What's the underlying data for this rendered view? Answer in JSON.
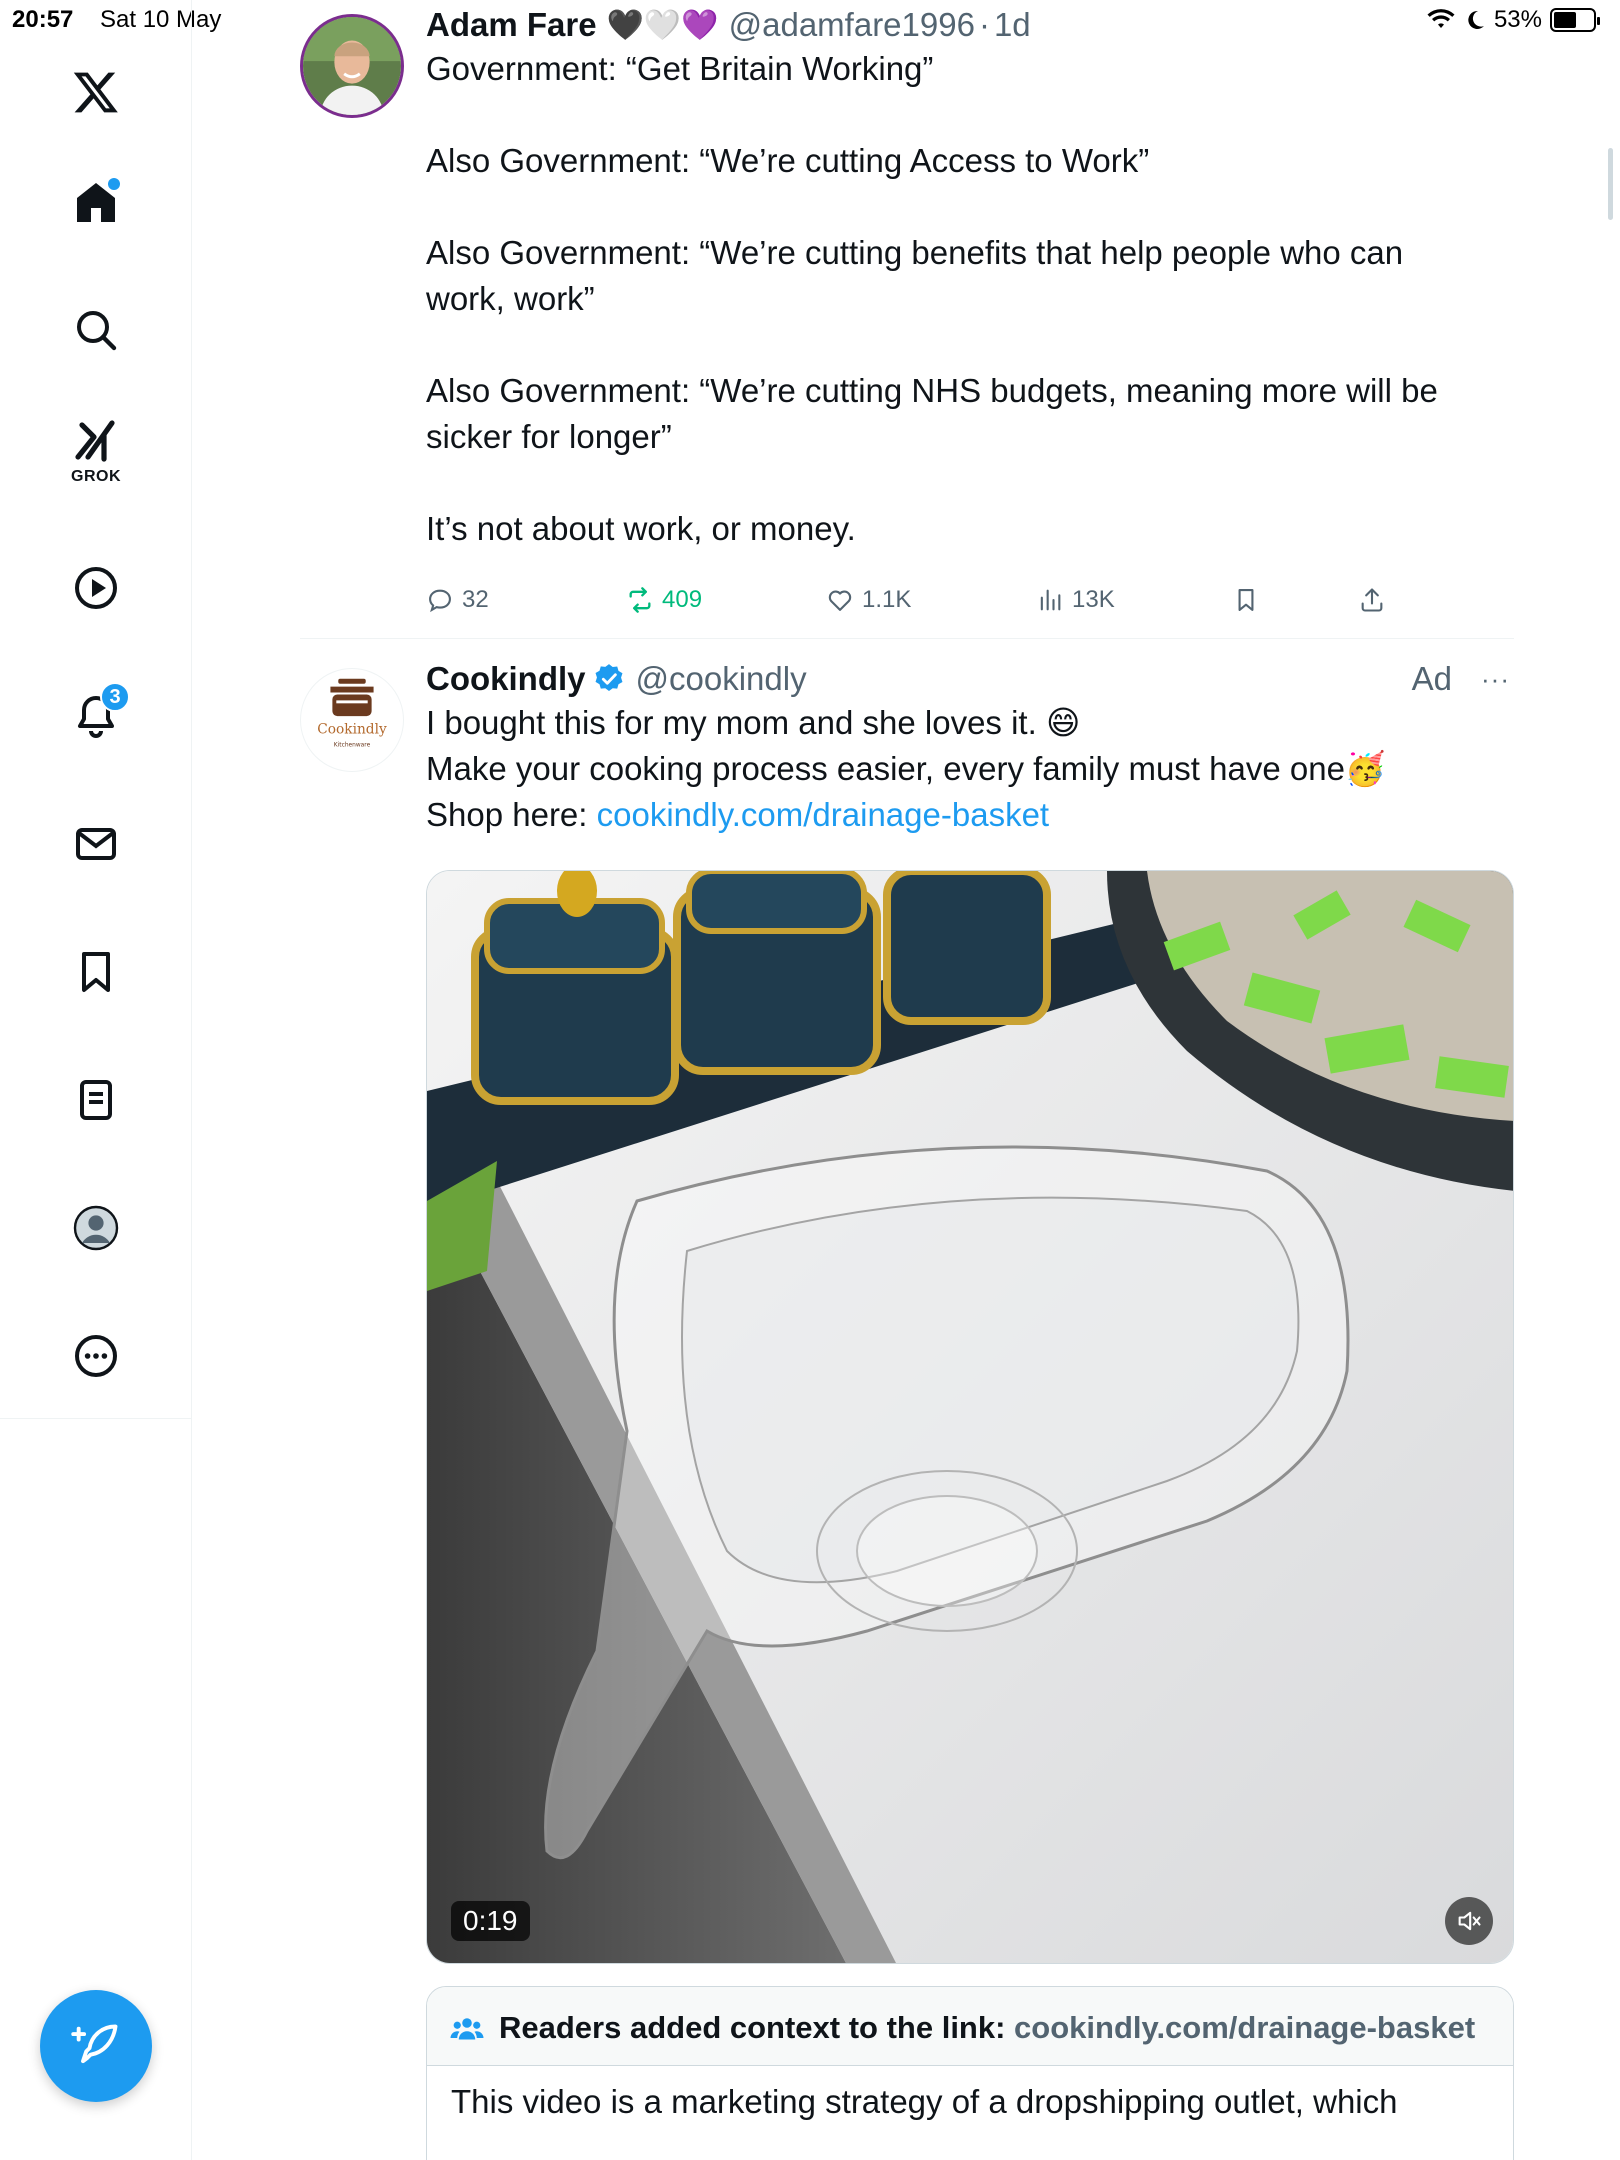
{
  "status_bar": {
    "time": "20:57",
    "date": "Sat 10 May",
    "battery": "53%"
  },
  "sidebar": {
    "grok_label": "GROK",
    "notifications_badge": "3",
    "items": [
      "x-logo",
      "home",
      "search",
      "grok",
      "videos",
      "notifications",
      "messages",
      "bookmarks",
      "lists",
      "profile",
      "more"
    ]
  },
  "tweets": [
    {
      "name": "Adam Fare",
      "emojis": "🖤🤍💜",
      "handle": "@adamfare1996",
      "separator": "·",
      "time": "1d",
      "paragraphs": [
        "Government: “Get Britain Working”",
        "Also Government: “We’re cutting Access to Work”",
        "Also Government: “We’re cutting benefits that help people who can work, work”",
        "Also Government: “We’re cutting NHS budgets, meaning more will be sicker for longer”",
        "It’s not about work, or money."
      ],
      "replies": "32",
      "reposts": "409",
      "likes": "1.1K",
      "views": "13K"
    },
    {
      "name": "Cookindly",
      "handle": "@cookindly",
      "ad_label": "Ad",
      "more": "···",
      "line1": "I bought this for my mom and she loves it. 😄",
      "line2": "Make your cooking process easier, every family must have one🥳",
      "line3_prefix": "Shop here: ",
      "link": "cookindly.com/drainage-basket",
      "video_duration": "0:19",
      "logo_text": "Cookindly",
      "logo_sub": "Kitchenware",
      "notes_heading": "Readers added context to the link: ",
      "notes_link": "cookindly.com/drainage-basket",
      "notes_text": "This video is a marketing strategy of a dropshipping outlet, which"
    }
  ],
  "colors": {
    "accent": "#1d9bf0",
    "repost_active": "#00ba7c",
    "secondary_text": "#536471"
  }
}
